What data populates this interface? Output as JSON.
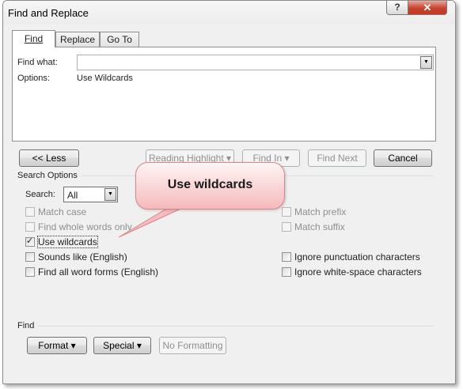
{
  "window": {
    "title": "Find and Replace",
    "help_glyph": "?",
    "close_glyph": "✕"
  },
  "tabs": [
    {
      "label": "Find",
      "active": true
    },
    {
      "label": "Replace",
      "active": false
    },
    {
      "label": "Go To",
      "active": false
    }
  ],
  "find_panel": {
    "find_what_label": "Find what:",
    "find_what_value": "",
    "options_label": "Options:",
    "options_value": "Use Wildcards"
  },
  "buttons": {
    "less": "<< Less",
    "reading_highlight": "Reading Highlight",
    "find_in": "Find In",
    "find_next": "Find Next",
    "cancel": "Cancel"
  },
  "search_options": {
    "section_title": "Search Options",
    "search_label": "Search:",
    "search_value": "All"
  },
  "checkboxes": {
    "match_case": {
      "label": "Match case",
      "checked": false,
      "enabled": false
    },
    "whole_words": {
      "label": "Find whole words only",
      "checked": false,
      "enabled": false
    },
    "use_wildcards": {
      "label": "Use wildcards",
      "checked": true,
      "enabled": true
    },
    "sounds_like": {
      "label": "Sounds like (English)",
      "checked": false,
      "enabled": true
    },
    "word_forms": {
      "label": "Find all word forms (English)",
      "checked": false,
      "enabled": true
    },
    "match_prefix": {
      "label": "Match prefix",
      "checked": false,
      "enabled": false
    },
    "match_suffix": {
      "label": "Match suffix",
      "checked": false,
      "enabled": false
    },
    "ignore_punct": {
      "label": "Ignore punctuation characters",
      "checked": false,
      "enabled": true
    },
    "ignore_space": {
      "label": "Ignore white-space characters",
      "checked": false,
      "enabled": true
    }
  },
  "find_section": {
    "title": "Find",
    "format": "Format",
    "special": "Special",
    "no_formatting": "No Formatting"
  },
  "callout": {
    "text": "Use wildcards"
  },
  "icons": {
    "dropdown": "dropdown-arrow-icon",
    "small_arrow": "▾"
  }
}
